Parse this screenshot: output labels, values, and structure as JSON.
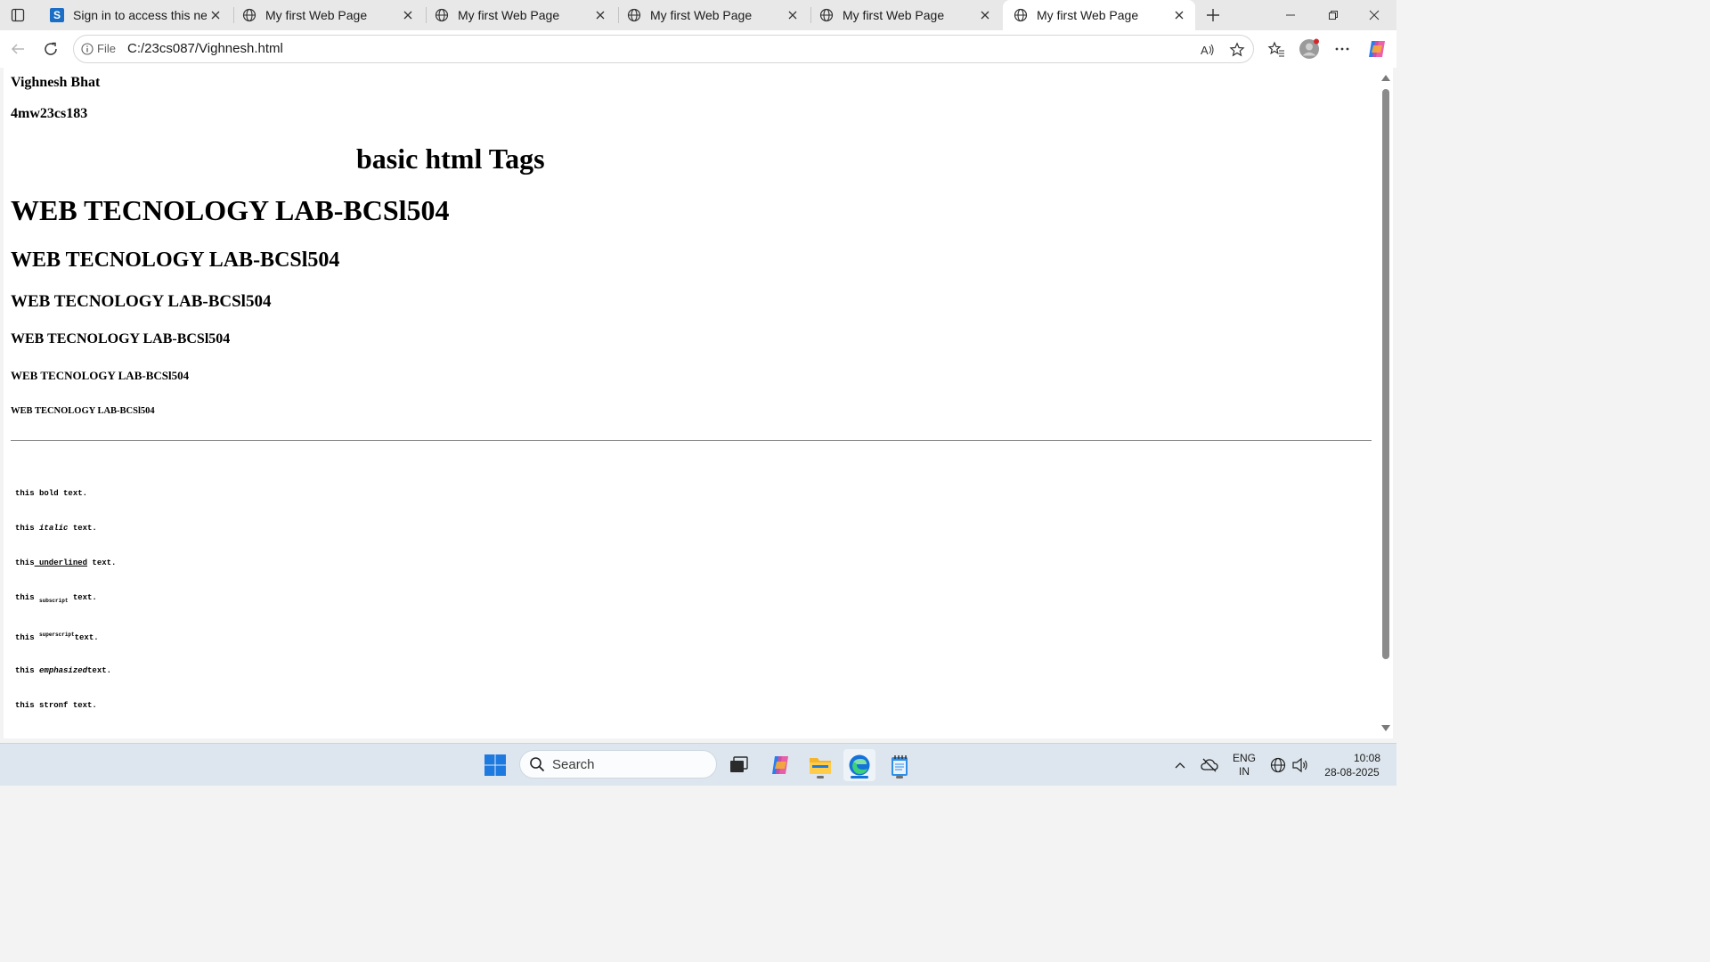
{
  "browser": {
    "tabs": [
      {
        "title": "Sign in to access this network",
        "favicon": "s-logo-icon",
        "active": false
      },
      {
        "title": "My first Web Page",
        "favicon": "globe-icon",
        "active": false
      },
      {
        "title": "My first Web Page",
        "favicon": "globe-icon",
        "active": false
      },
      {
        "title": "My first Web Page",
        "favicon": "globe-icon",
        "active": false
      },
      {
        "title": "My first Web Page",
        "favicon": "globe-icon",
        "active": false
      },
      {
        "title": "My first Web Page",
        "favicon": "globe-icon",
        "active": true
      }
    ],
    "address": {
      "scheme_label": "File",
      "url": "C:/23cs087/Vighnesh.html"
    }
  },
  "page": {
    "name": "Vighnesh Bhat",
    "usn": "4mw23cs183",
    "title": "basic html Tags",
    "headings": [
      "WEB TECNOLOGY LAB-BCSl504",
      "WEB TECNOLOGY LAB-BCSl504",
      "WEB TECNOLOGY LAB-BCSl504",
      "WEB TECNOLOGY LAB-BCSl504",
      "WEB TECNOLOGY LAB-BCSl504",
      "WEB TECNOLOGY LAB-BCSl504"
    ],
    "lines": [
      {
        "pre": "this ",
        "styled": "bold",
        "post": " text."
      },
      {
        "pre": "this ",
        "styled": "italic",
        "post": " text."
      },
      {
        "pre": "this",
        "styled": " underlined",
        "post": " text."
      },
      {
        "pre": "this ",
        "styled": "subscript",
        "post": " text."
      },
      {
        "pre": "this ",
        "styled": "superscript",
        "post": "text."
      },
      {
        "pre": "this ",
        "styled": "emphasized",
        "post": "text."
      },
      {
        "pre": "this ",
        "styled": "stronf",
        "post": " text."
      }
    ]
  },
  "taskbar": {
    "search_placeholder": "Search",
    "language": "ENG",
    "region": "IN",
    "time": "10:08",
    "date": "28-08-2025"
  }
}
